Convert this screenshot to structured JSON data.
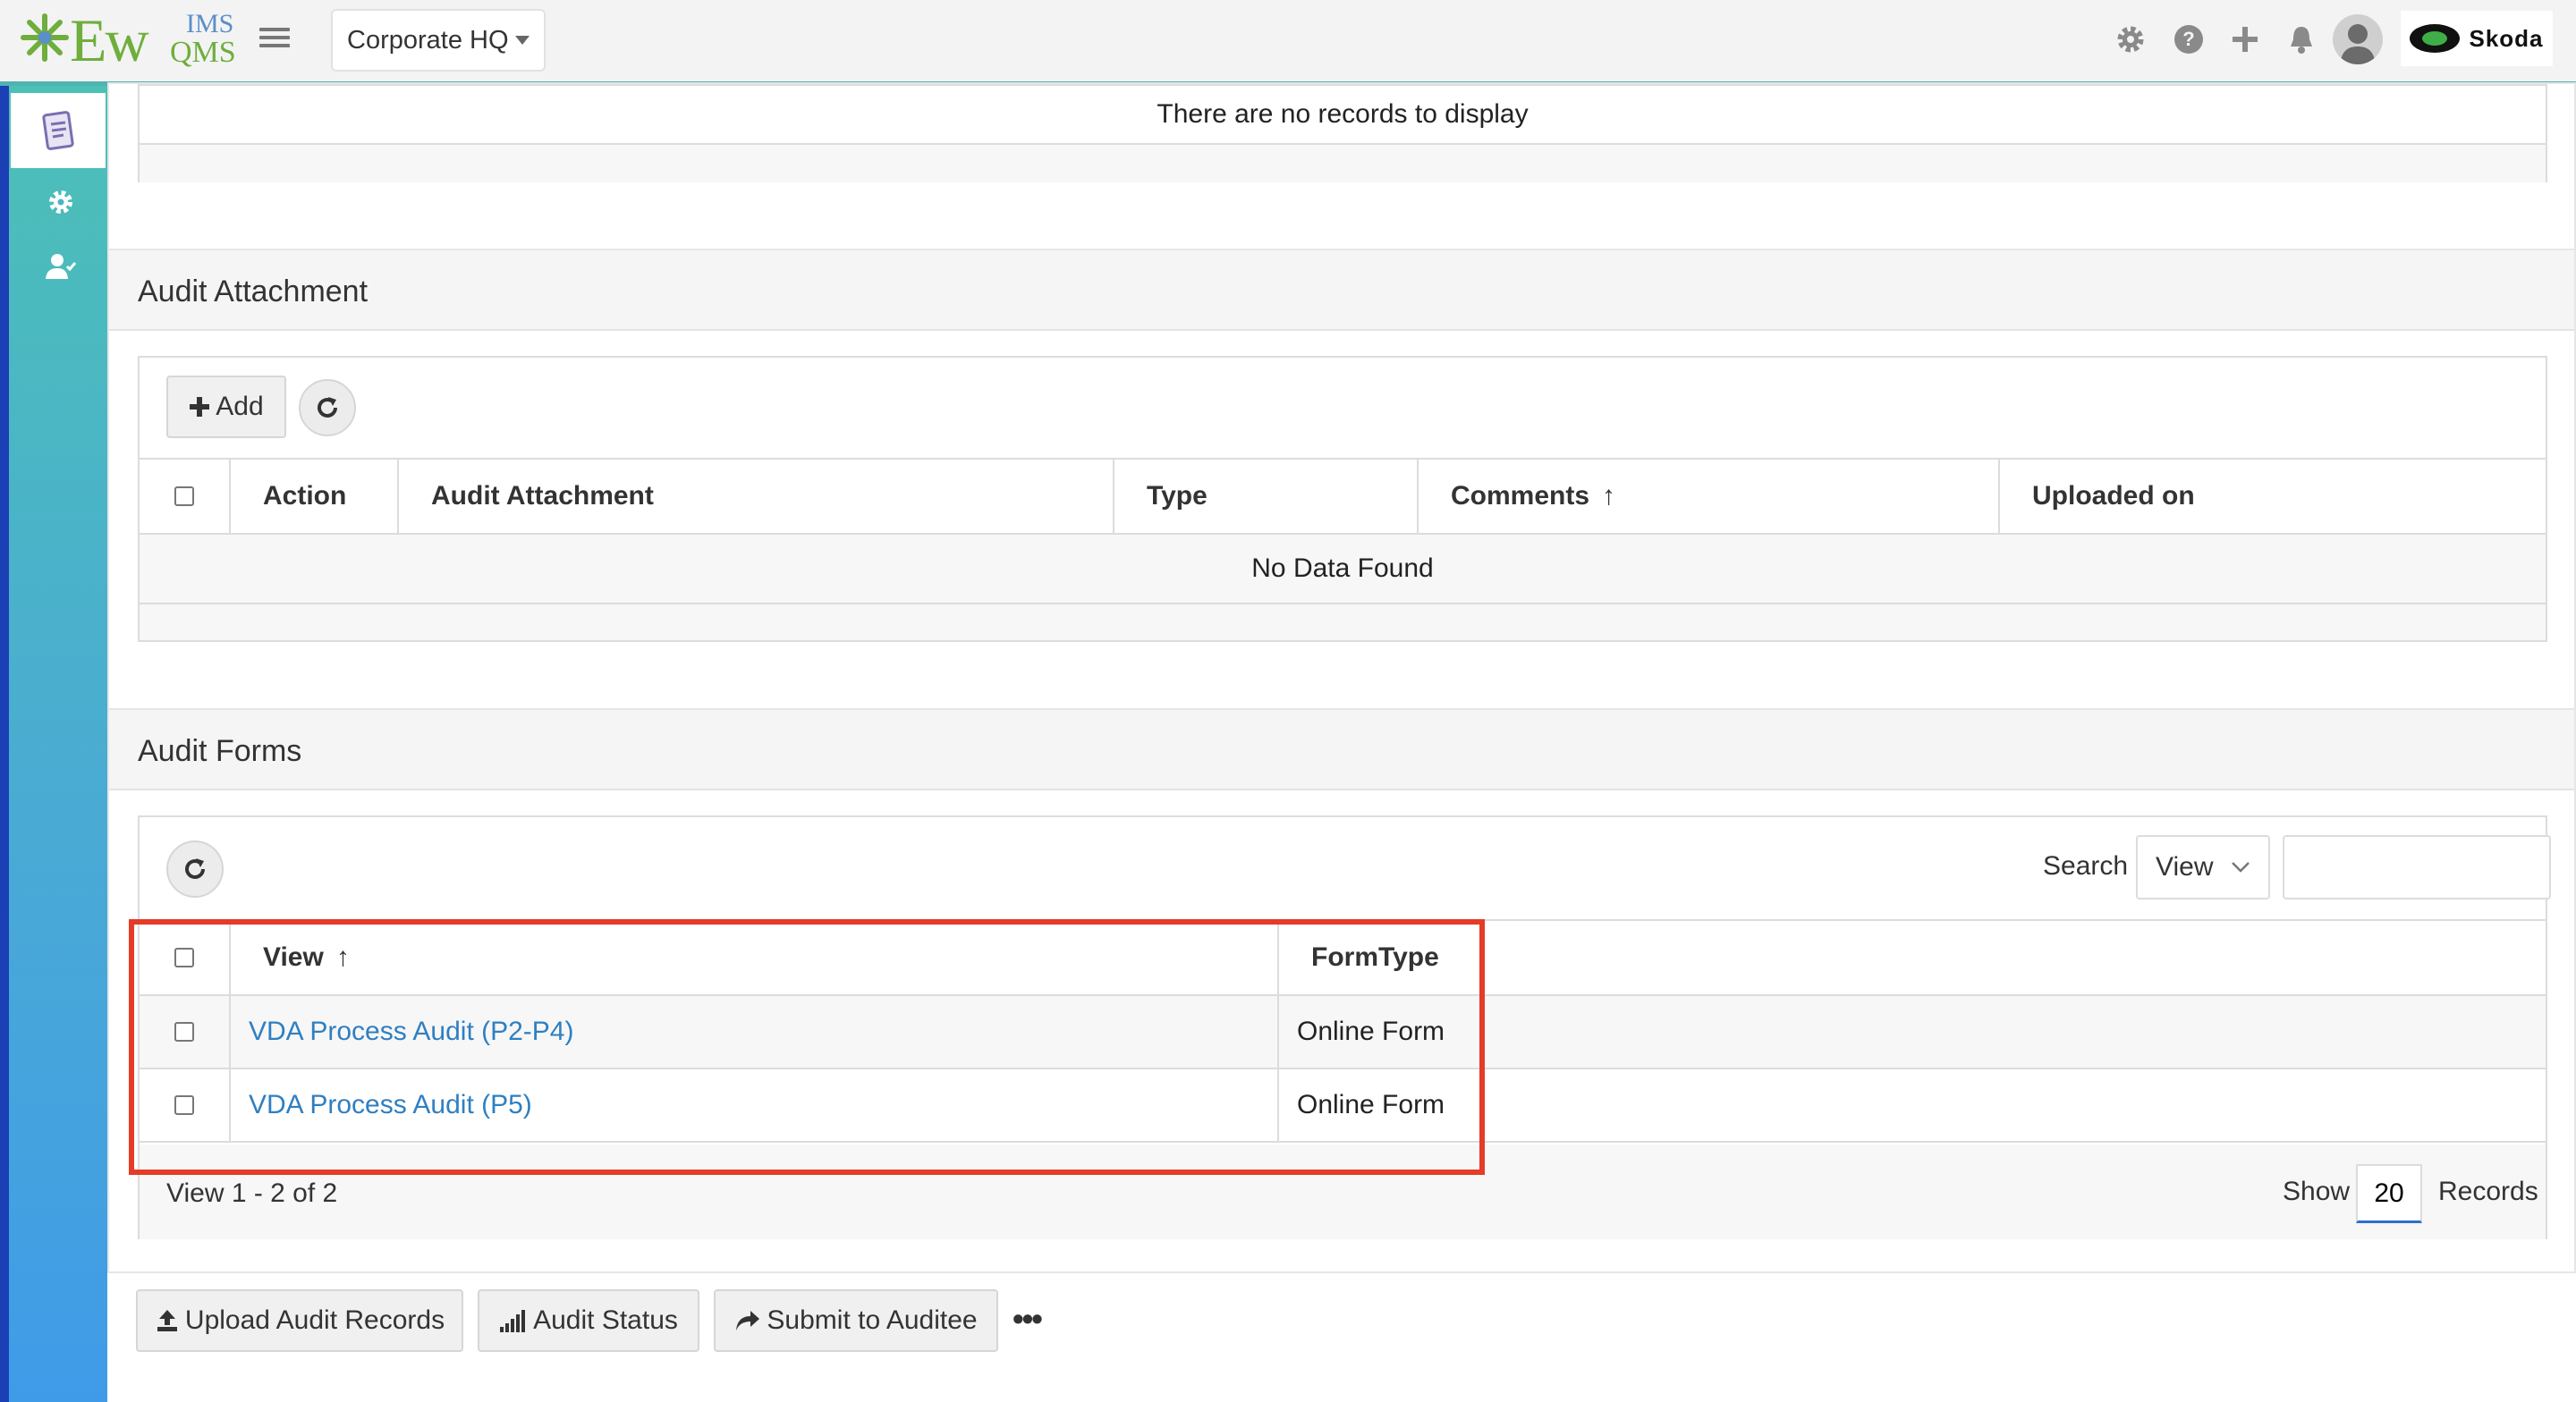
{
  "header": {
    "logo": {
      "main": "Ew",
      "top": "IMS",
      "bottom": "QMS"
    },
    "site_selector": "Corporate HQ",
    "icons": [
      "gear-icon",
      "help-icon",
      "plus-icon",
      "bell-icon",
      "user-avatar"
    ],
    "brand": "Skoda"
  },
  "sidebar": {
    "icons": [
      "audit-document-icon",
      "settings-gear-icon",
      "user-check-icon"
    ]
  },
  "top_panel": {
    "empty_message": "There are no records to display"
  },
  "audit_attachment": {
    "title": "Audit Attachment",
    "add_label": "Add",
    "columns": [
      "Action",
      "Audit Attachment",
      "Type",
      "Comments",
      "Uploaded on"
    ],
    "empty_message": "No Data Found"
  },
  "audit_forms": {
    "title": "Audit Forms",
    "search_label": "Search",
    "search_field_select": "View",
    "search_value": "",
    "columns": [
      "View",
      "FormType"
    ],
    "rows": [
      {
        "view": "VDA Process Audit (P2-P4)",
        "form_type": "Online Form"
      },
      {
        "view": "VDA Process Audit (P5)",
        "form_type": "Online Form"
      }
    ],
    "pager_info": "View 1 - 2 of 2",
    "show_label": "Show",
    "page_size": "20",
    "records_label": "Records"
  },
  "actions": {
    "upload": "Upload Audit Records",
    "status": "Audit Status",
    "submit": "Submit to Auditee",
    "more": "•••"
  },
  "colors": {
    "accent_teal": "#4fb3b1",
    "link": "#2f7fc1",
    "highlight_red": "#e53b27",
    "sidebar_edge": "#1b3fb5"
  }
}
